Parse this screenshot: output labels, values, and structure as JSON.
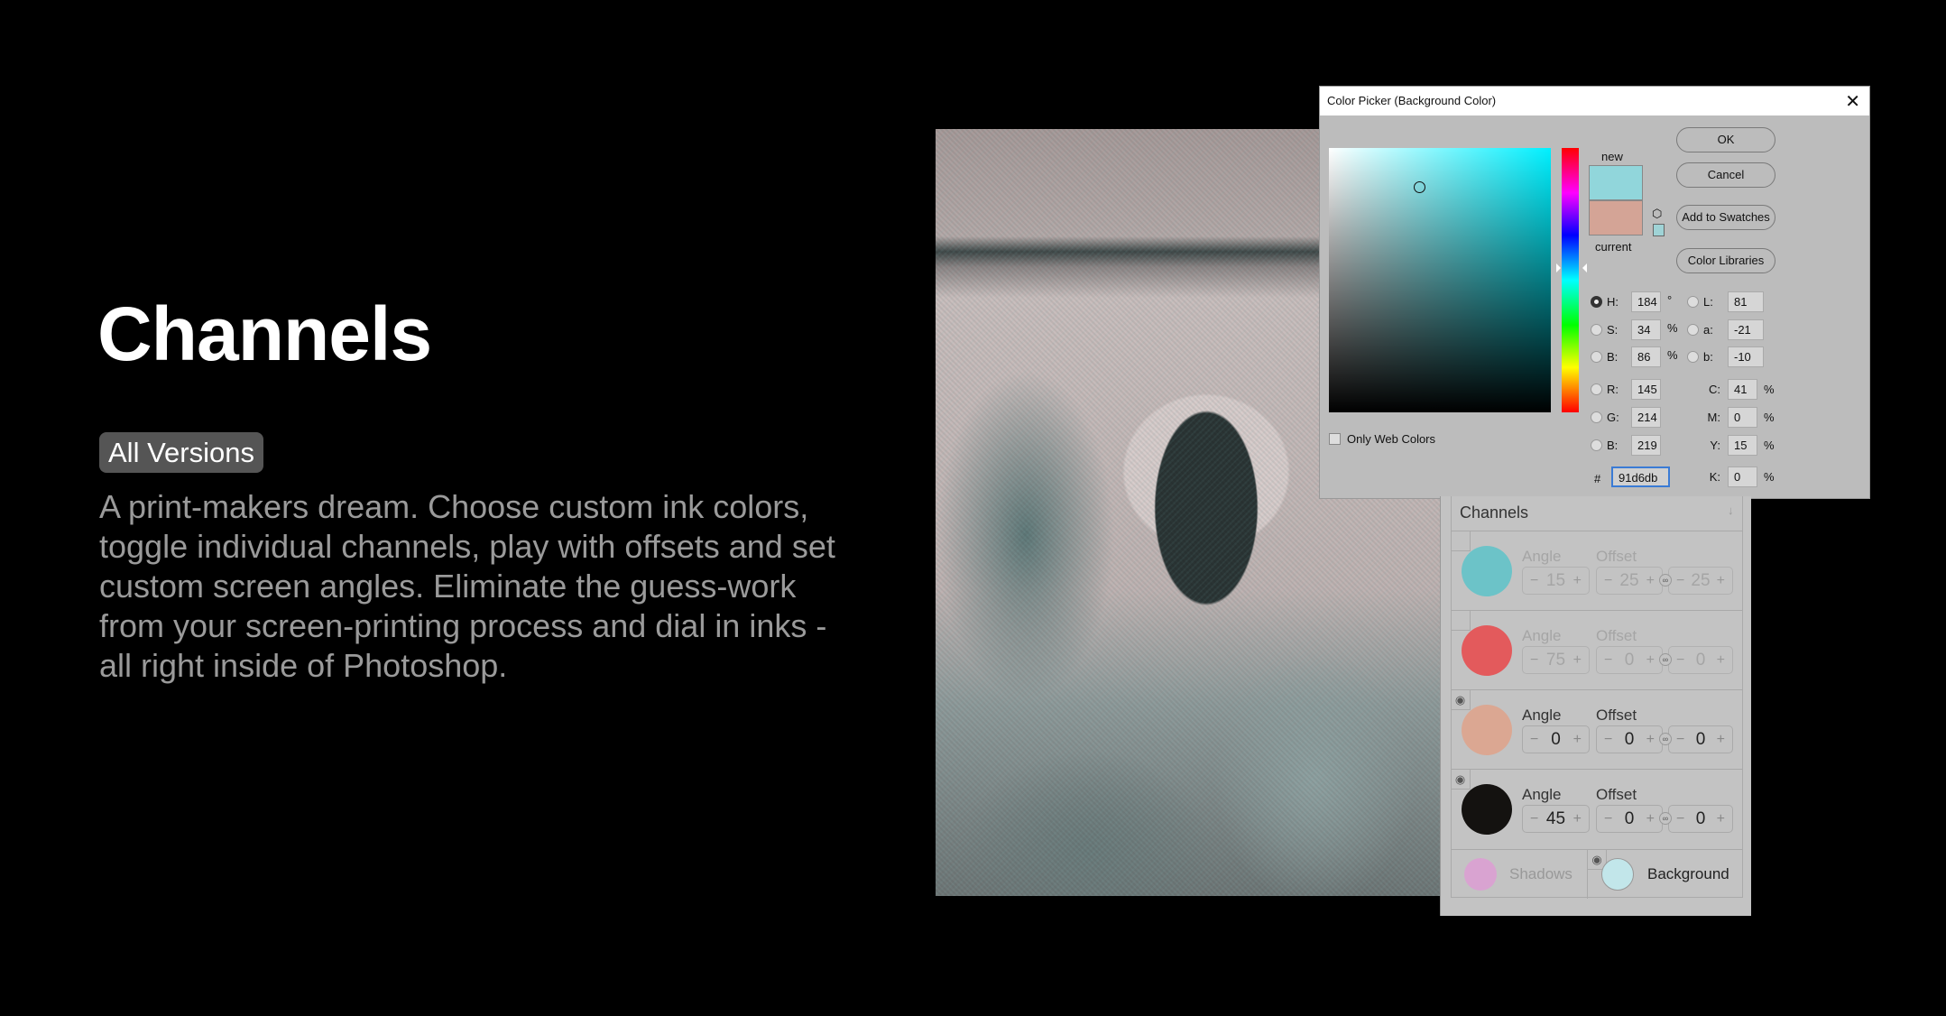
{
  "hero": {
    "title": "Channels",
    "badge": "All Versions",
    "description": "A print-makers dream. Choose custom ink colors, toggle individual channels, play with offsets and set custom screen angles. Eliminate the guess-work from your screen-printing process and dial in inks - all right inside of Photoshop."
  },
  "picker": {
    "title": "Color Picker (Background Color)",
    "new_label": "new",
    "current_label": "current",
    "new_color": "#91d6db",
    "current_color": "#d4a496",
    "buttons": {
      "ok": "OK",
      "cancel": "Cancel",
      "add": "Add to Swatches",
      "libraries": "Color Libraries"
    },
    "web_colors": "Only Web Colors",
    "hsb": [
      {
        "label": "H:",
        "value": "184",
        "unit": "°"
      },
      {
        "label": "S:",
        "value": "34",
        "unit": "%"
      },
      {
        "label": "B:",
        "value": "86",
        "unit": "%"
      }
    ],
    "rgb": [
      {
        "label": "R:",
        "value": "145"
      },
      {
        "label": "G:",
        "value": "214"
      },
      {
        "label": "B:",
        "value": "219"
      }
    ],
    "lab": [
      {
        "label": "L:",
        "value": "81"
      },
      {
        "label": "a:",
        "value": "-21"
      },
      {
        "label": "b:",
        "value": "-10"
      }
    ],
    "cmyk": [
      {
        "label": "C:",
        "value": "41",
        "unit": "%"
      },
      {
        "label": "M:",
        "value": "0",
        "unit": "%"
      },
      {
        "label": "Y:",
        "value": "15",
        "unit": "%"
      },
      {
        "label": "K:",
        "value": "0",
        "unit": "%"
      }
    ],
    "hash": "#",
    "hex": "91d6db"
  },
  "channels": {
    "title": "Channels",
    "angle_label": "Angle",
    "offset_label": "Offset",
    "rows": [
      {
        "color": "#6cc3c8",
        "angle": "15",
        "off_x": "25",
        "off_y": "25",
        "visible": false
      },
      {
        "color": "#e35a5c",
        "angle": "75",
        "off_x": "0",
        "off_y": "0",
        "visible": false
      },
      {
        "color": "#dba792",
        "angle": "0",
        "off_x": "0",
        "off_y": "0",
        "visible": true
      },
      {
        "color": "#141210",
        "angle": "45",
        "off_x": "0",
        "off_y": "0",
        "visible": true
      }
    ],
    "shadows": {
      "label": "Shadows",
      "color": "#d9a3d1"
    },
    "background": {
      "label": "Background",
      "color": "#c2e6ea"
    }
  }
}
